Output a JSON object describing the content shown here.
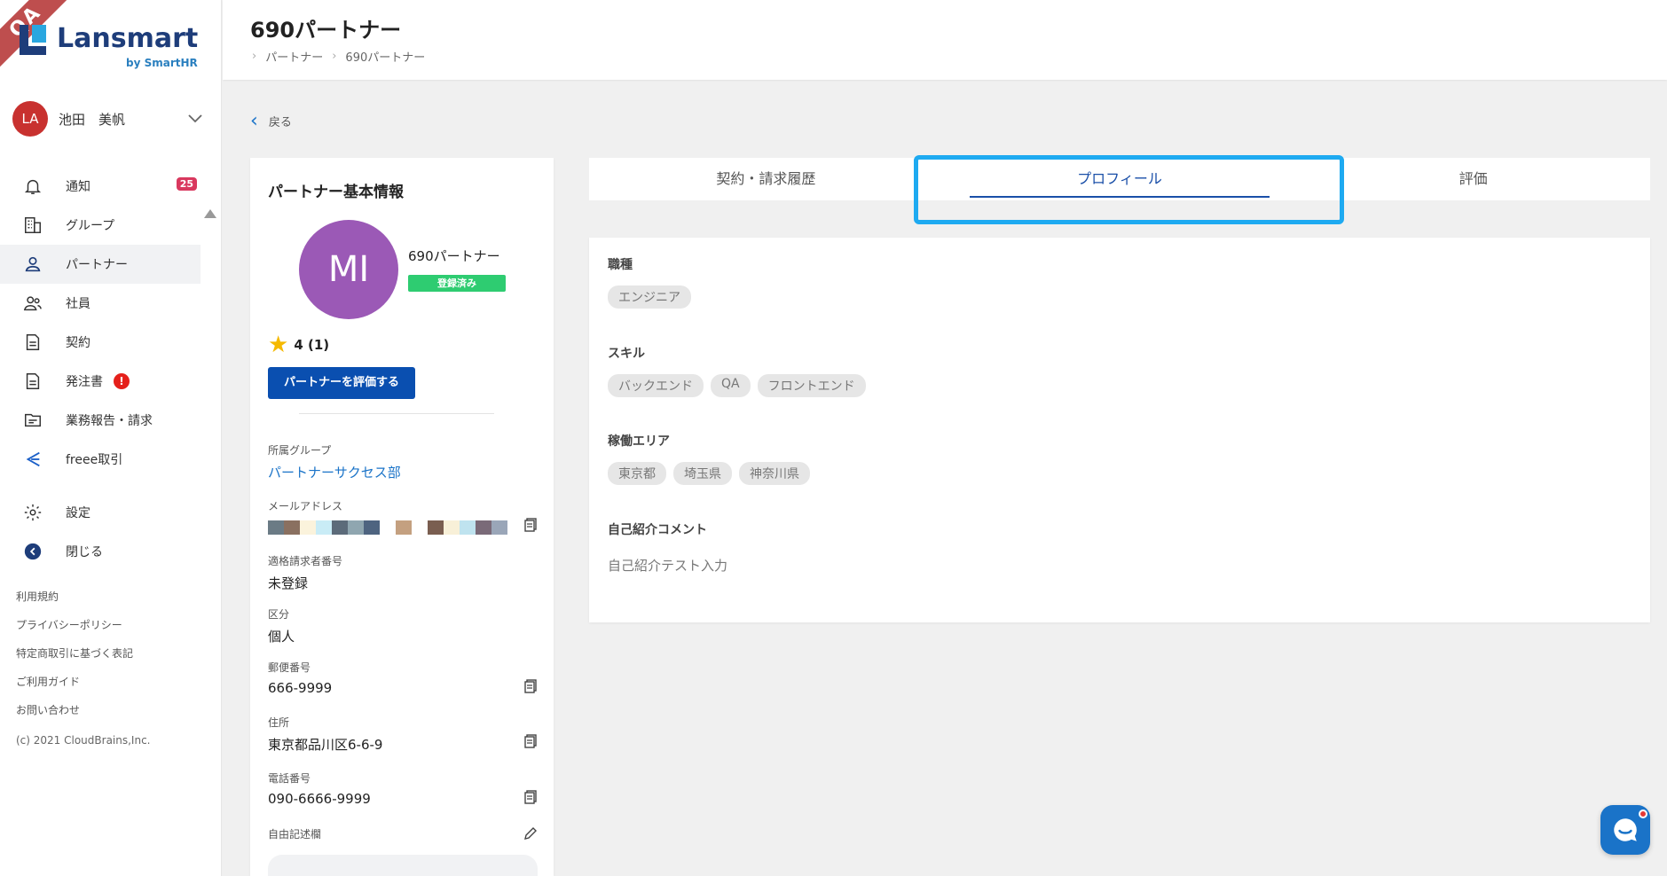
{
  "app": {
    "ribbon": "QA",
    "logo_text": "Lansmart",
    "logo_sub": "by SmartHR"
  },
  "user": {
    "initials": "LA",
    "name": "池田　美帆"
  },
  "nav": {
    "notifications": {
      "label": "通知",
      "count": "25"
    },
    "group": "グループ",
    "partner": "パートナー",
    "employee": "社員",
    "contract": "契約",
    "order": {
      "label": "発注書",
      "alert": "!"
    },
    "report": "業務報告・請求",
    "freee": "freee取引",
    "settings": "設定",
    "close": "閉じる"
  },
  "footer": {
    "links": [
      "利用規約",
      "プライバシーポリシー",
      "特定商取引に基づく表記",
      "ご利用ガイド",
      "お問い合わせ"
    ],
    "copyright": "(c) 2021 CloudBrains,Inc."
  },
  "header": {
    "title": "690パートナー",
    "breadcrumb": [
      "パートナー",
      "690パートナー"
    ]
  },
  "back_label": "戻る",
  "partner_card": {
    "title": "パートナー基本情報",
    "avatar_initials": "MI",
    "name": "690パートナー",
    "status": "登録済み",
    "rating": "4 (1)",
    "evaluate_button": "パートナーを評価する",
    "group_label": "所属グループ",
    "group_value": "パートナーサクセス部",
    "email_label": "メールアドレス",
    "invoice_label": "適格請求者番号",
    "invoice_value": "未登録",
    "category_label": "区分",
    "category_value": "個人",
    "postal_label": "郵便番号",
    "postal_value": "666-9999",
    "address_label": "住所",
    "address_value": "東京都品川区6-6-9",
    "phone_label": "電話番号",
    "phone_value": "090-6666-9999",
    "free_label": "自由記述欄"
  },
  "tabs": [
    "契約・請求履歴",
    "プロフィール",
    "評価"
  ],
  "profile": {
    "occupation_title": "職種",
    "occupation_chips": [
      "エンジニア"
    ],
    "skill_title": "スキル",
    "skill_chips": [
      "バックエンド",
      "QA",
      "フロントエンド"
    ],
    "area_title": "稼働エリア",
    "area_chips": [
      "東京都",
      "埼玉県",
      "神奈川県"
    ],
    "comment_title": "自己紹介コメント",
    "comment_text": "自己紹介テスト入力"
  },
  "colors": {
    "primary": "#0a4fb0",
    "accent": "#1eaaf1",
    "status_green": "#2ecc71",
    "avatar_purple": "#9b59b6",
    "avatar_red": "#c8312f",
    "badge_pink": "#d9385e"
  }
}
